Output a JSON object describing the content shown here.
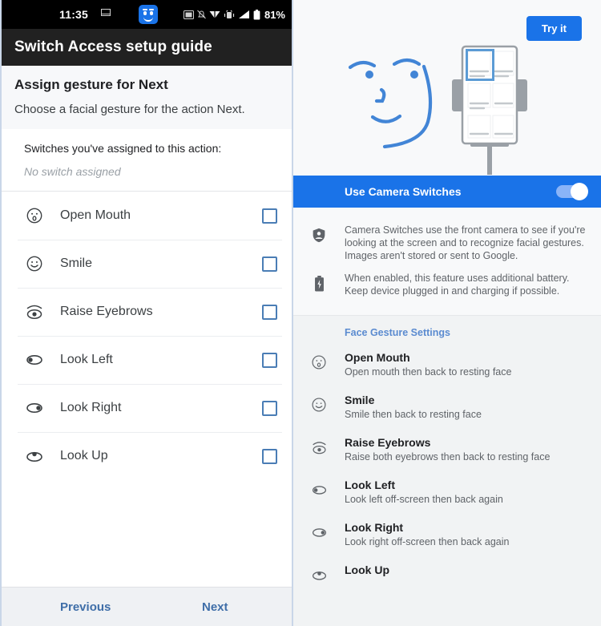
{
  "colors": {
    "accent_blue": "#1a73e8",
    "statusbar_bg": "#000000",
    "appbar_bg": "#212121",
    "checkbox_border": "#4a7db5",
    "footer_link": "#3f6ea8",
    "section_header": "#5b8bd0"
  },
  "left": {
    "statusbar": {
      "time": "11:35",
      "battery_percent": "81%",
      "icons": [
        "mail-icon",
        "camera-switches-face-icon",
        "screenshot-icon",
        "notifications-off-icon",
        "wifi-icon",
        "vibrate-icon",
        "signal-icon",
        "battery-icon"
      ]
    },
    "appbar": {
      "title": "Switch Access setup guide"
    },
    "intro": {
      "title": "Assign gesture for Next",
      "subtitle": "Choose a facial gesture for the action Next."
    },
    "assigned": {
      "label": "Switches you've assigned to this action:",
      "value": "No switch assigned"
    },
    "gestures": [
      {
        "icon": "open-mouth-icon",
        "label": "Open Mouth",
        "checked": false
      },
      {
        "icon": "smile-icon",
        "label": "Smile",
        "checked": false
      },
      {
        "icon": "raise-eyebrows-icon",
        "label": "Raise Eyebrows",
        "checked": false
      },
      {
        "icon": "look-left-icon",
        "label": "Look Left",
        "checked": false
      },
      {
        "icon": "look-right-icon",
        "label": "Look Right",
        "checked": false
      },
      {
        "icon": "look-up-icon",
        "label": "Look Up",
        "checked": false
      }
    ],
    "footer": {
      "previous": "Previous",
      "next": "Next"
    }
  },
  "right": {
    "hero": {
      "try_it": "Try it",
      "illustration": "face-and-phone-on-stand-illustration"
    },
    "camera_switches": {
      "label": "Use Camera Switches",
      "toggle_state": "on"
    },
    "info": [
      {
        "icon": "shield-person-icon",
        "text": "Camera Switches use the front camera to see if you're looking at the screen and to recognize facial gestures. Images aren't stored or sent to Google."
      },
      {
        "icon": "battery-charging-icon",
        "text": "When enabled, this feature uses additional battery. Keep device plugged in and charging if possible."
      }
    ],
    "face_gesture_settings": {
      "header": "Face Gesture Settings",
      "items": [
        {
          "icon": "open-mouth-icon",
          "title": "Open Mouth",
          "desc": "Open mouth then back to resting face"
        },
        {
          "icon": "smile-icon",
          "title": "Smile",
          "desc": "Smile then back to resting face"
        },
        {
          "icon": "raise-eyebrows-icon",
          "title": "Raise Eyebrows",
          "desc": "Raise both eyebrows then back to resting face"
        },
        {
          "icon": "look-left-icon",
          "title": "Look Left",
          "desc": "Look left off-screen then back again"
        },
        {
          "icon": "look-right-icon",
          "title": "Look Right",
          "desc": "Look right off-screen then back again"
        },
        {
          "icon": "look-up-icon",
          "title": "Look Up",
          "desc": ""
        }
      ]
    }
  }
}
